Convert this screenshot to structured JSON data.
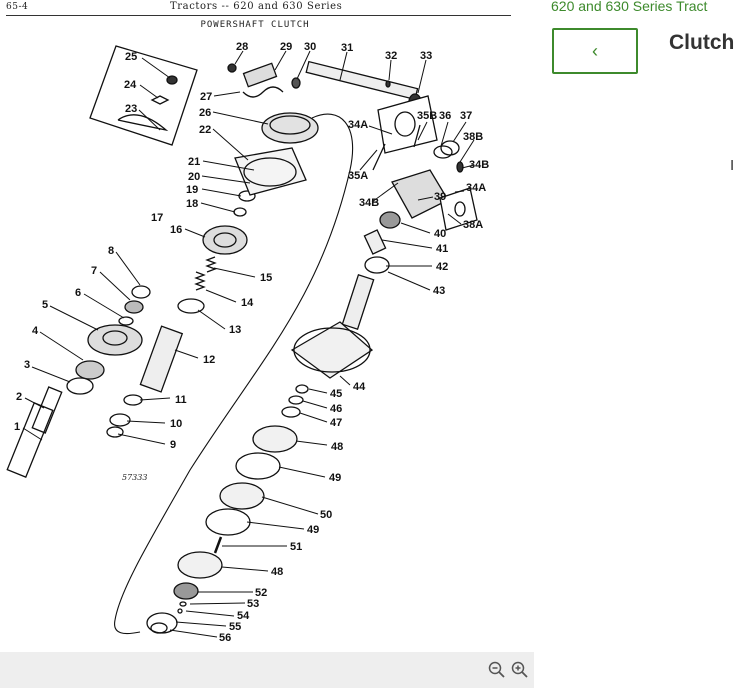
{
  "document": {
    "page_number": "65-4",
    "title": "Tractors -- 620 and 630 Series",
    "section_title": "POWERSHAFT CLUTCH",
    "figure_number": "57333"
  },
  "callouts": [
    "1",
    "2",
    "3",
    "4",
    "5",
    "6",
    "7",
    "8",
    "9",
    "10",
    "11",
    "12",
    "13",
    "14",
    "15",
    "16",
    "17",
    "18",
    "19",
    "20",
    "21",
    "22",
    "23",
    "24",
    "25",
    "26",
    "27",
    "28",
    "29",
    "30",
    "31",
    "32",
    "33",
    "34A",
    "34A",
    "34B",
    "34B",
    "35A",
    "35B",
    "36",
    "37",
    "38A",
    "38B",
    "39",
    "40",
    "41",
    "42",
    "43",
    "44",
    "45",
    "46",
    "47",
    "48",
    "49",
    "50",
    "49",
    "51",
    "48",
    "52",
    "53",
    "54",
    "55",
    "56"
  ],
  "toolbar": {
    "zoom_out_icon": "zoom-out-icon",
    "zoom_in_icon": "zoom-in-icon"
  },
  "sidebar": {
    "breadcrumb": "620 and 630 Series Tract",
    "back_label": "‹",
    "title": "Clutch,",
    "fragment": "I"
  },
  "colors": {
    "accent": "#3d8a2c",
    "toolbar_bg": "#eeeeee",
    "text": "#333333"
  }
}
